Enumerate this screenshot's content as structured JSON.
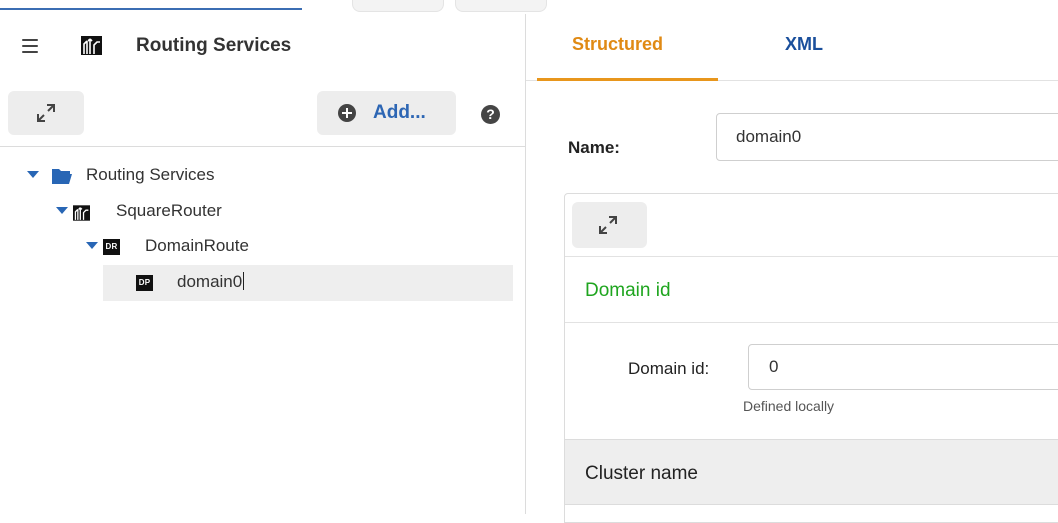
{
  "app": {
    "title": "Routing Services"
  },
  "toolbar": {
    "add_label": "Add...",
    "help_label": "?"
  },
  "tree": {
    "root": {
      "label": "Routing Services",
      "icon": "folder-open-icon"
    },
    "router": {
      "label": "SquareRouter",
      "icon": "router-icon"
    },
    "domain_route": {
      "label": "DomainRoute",
      "badge": "DR"
    },
    "domain": {
      "label": "domain0",
      "badge": "DP"
    }
  },
  "tabs": [
    {
      "label": "Structured",
      "active": true
    },
    {
      "label": "XML",
      "active": false
    }
  ],
  "form": {
    "name_label": "Name:",
    "name_value": "domain0",
    "section_title": "Domain id",
    "domain_id_label": "Domain id:",
    "domain_id_value": "0",
    "domain_id_hint": "Defined locally",
    "cluster_section": "Cluster name"
  },
  "colors": {
    "accent_orange": "#e08a14",
    "link_blue": "#2d66b4",
    "section_green": "#1fa51f",
    "tree_caret_blue": "#2866b5"
  }
}
